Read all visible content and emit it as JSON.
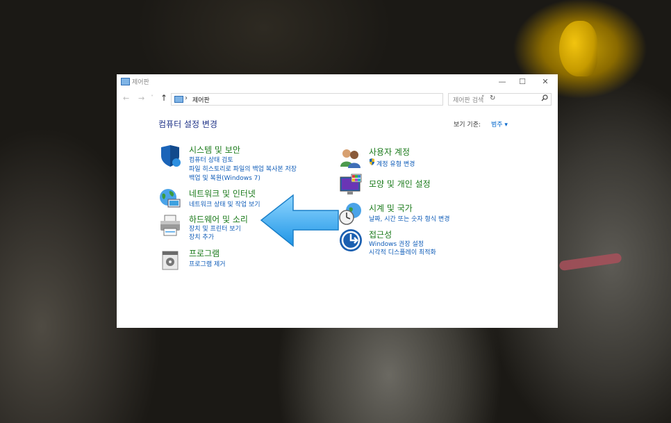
{
  "window": {
    "title": "제어판"
  },
  "navbar": {
    "back": "←",
    "forward": "→",
    "recent": "˅",
    "up": "↑",
    "breadcrumb_sep": "›",
    "address": "제어판",
    "dropdown": "˅",
    "refresh": "↻"
  },
  "search": {
    "placeholder": "제어판 검색"
  },
  "heading": "컴퓨터 설정 변경",
  "view_by": {
    "label": "보기 기준:",
    "value": "범주 ▾"
  },
  "categories_left": [
    {
      "title": "시스템 및 보안",
      "links": [
        "컴퓨터 상태 검토",
        "파일 히스토리로 파일의 백업 복사본 저장",
        "백업 및 복원(Windows 7)"
      ]
    },
    {
      "title": "네트워크 및 인터넷",
      "links": [
        "네트워크 상태 및 작업 보기"
      ]
    },
    {
      "title": "하드웨어 및 소리",
      "links": [
        "장치 및 프린터 보기",
        "장치 추가"
      ]
    },
    {
      "title": "프로그램",
      "links": [
        "프로그램 제거"
      ]
    }
  ],
  "categories_right": [
    {
      "title": "사용자 계정",
      "links": [
        "계정 유형 변경"
      ]
    },
    {
      "title": "모양 및 개인 설정",
      "links": []
    },
    {
      "title": "시계 및 국가",
      "links": [
        "날짜, 시간 또는 숫자 형식 변경"
      ]
    },
    {
      "title": "접근성",
      "links": [
        "Windows 권장 설정",
        "시각적 디스플레이 최적화"
      ]
    }
  ],
  "window_controls": {
    "minimize": "—",
    "maximize": "☐",
    "close": "✕"
  },
  "colors": {
    "category_title": "#1a7a1a",
    "link": "#0f5cb8",
    "heading": "#1e3287",
    "arrow": "#3fb2ef"
  }
}
